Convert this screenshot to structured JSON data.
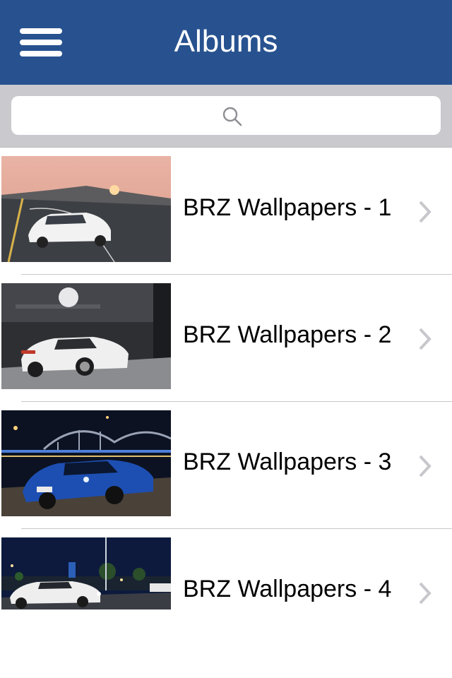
{
  "header": {
    "title": "Albums",
    "menu_icon": "hamburger-menu-icon"
  },
  "search": {
    "placeholder": "",
    "icon": "search-icon"
  },
  "albums": [
    {
      "label": "BRZ Wallpapers - 1",
      "thumbnail": "white car on road at sunset"
    },
    {
      "label": "BRZ Wallpapers - 2",
      "thumbnail": "white widebody car in garage"
    },
    {
      "label": "BRZ Wallpapers - 3",
      "thumbnail": "blue car near bridge at night"
    },
    {
      "label": "BRZ Wallpapers - 4",
      "thumbnail": "white car at night street"
    }
  ],
  "colors": {
    "nav_bg": "#28528f",
    "search_bg": "#c9c9ce",
    "separator": "#c8c7cc",
    "chevron": "#c7c7cc"
  }
}
